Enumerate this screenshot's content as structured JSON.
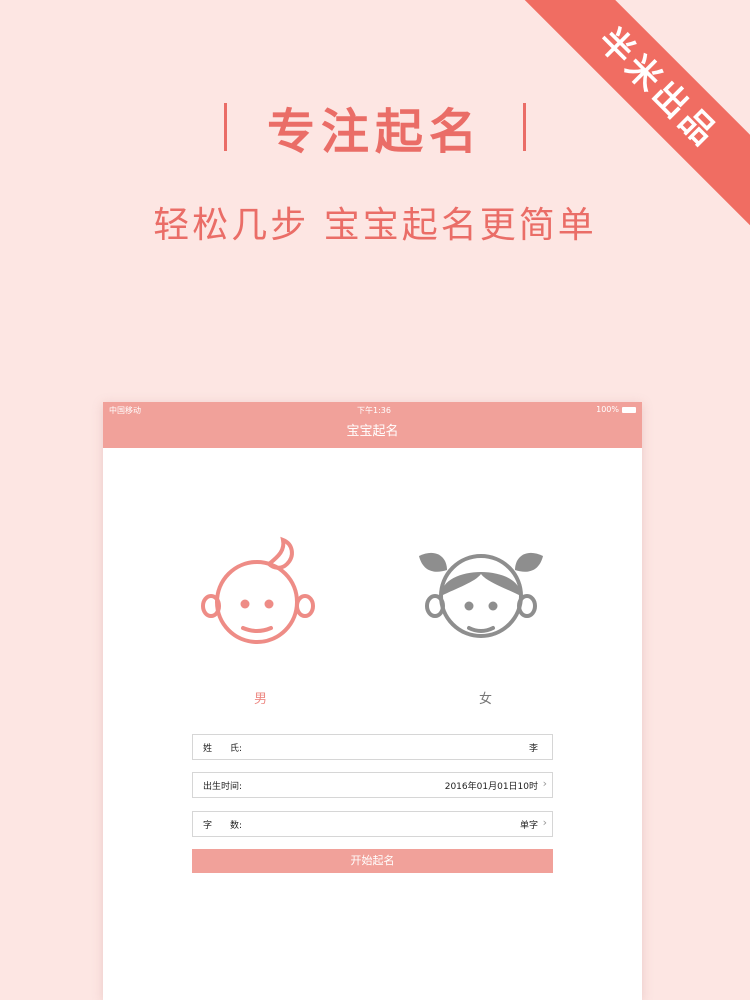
{
  "ribbon": {
    "text": "半米出品"
  },
  "promo": {
    "headline": "专注起名",
    "subline": "轻松几步 宝宝起名更简单"
  },
  "status_bar": {
    "carrier": "中国移动",
    "time": "下午1:36",
    "battery": "100%"
  },
  "nav": {
    "title": "宝宝起名"
  },
  "gender": {
    "male_label": "男",
    "female_label": "女",
    "selected": "male",
    "male_color": "#ee8c86",
    "female_color": "#8e8e8e"
  },
  "form": {
    "surname_label": "姓　　氏:",
    "surname_value": "李",
    "birth_label": "出生时间:",
    "birth_value": "2016年01月01日10时",
    "count_label": "字　　数:",
    "count_value": "单字",
    "chevron_icon": "chevron-right-icon"
  },
  "actions": {
    "start_label": "开始起名"
  },
  "colors": {
    "accent": "#f1a19a",
    "brand_red": "#ea6d67",
    "background": "#fde6e3"
  }
}
